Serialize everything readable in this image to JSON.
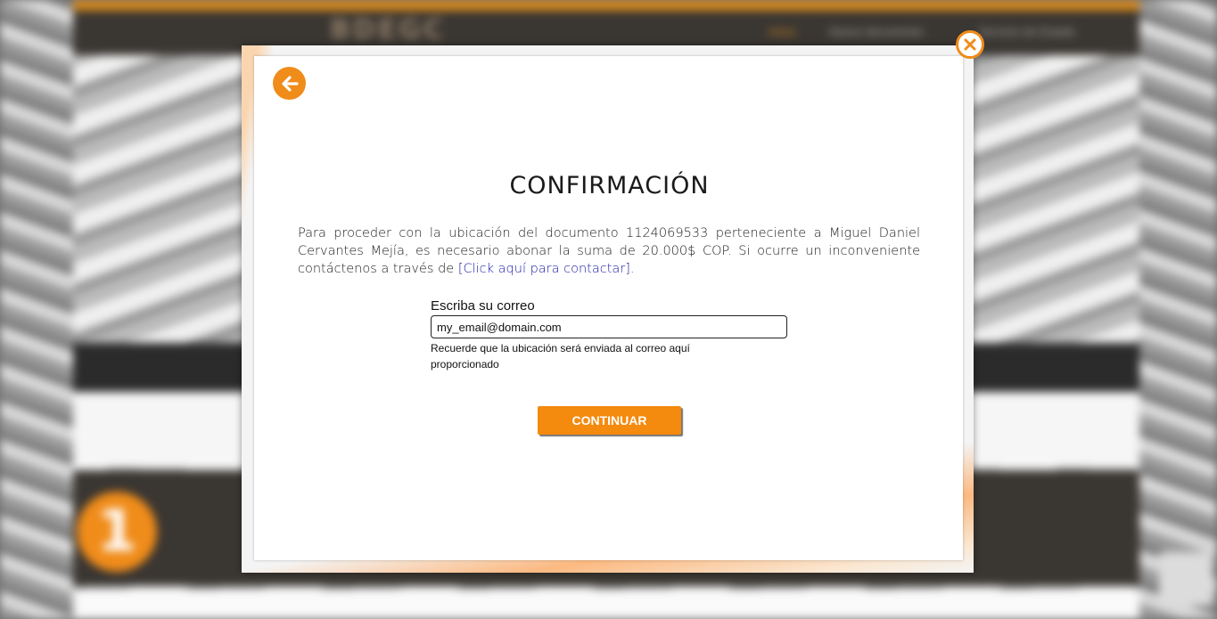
{
  "background": {
    "logo": "BDEGC",
    "nav": [
      "Inicio",
      "Nuevo documento",
      "Servicio de Estado"
    ],
    "step_number": "1"
  },
  "modal": {
    "title": "CONFIRMACIÓN",
    "paragraph_text": "Para proceder con la ubicación del documento 1124069533 perteneciente a Miguel Daniel Cervantes Mejía, es necesario abonar la suma de 20.000$ COP. Si ocurre un inconveniente contáctenos a través de ",
    "contact_link": "[Click aquí para contactar]",
    "paragraph_end": ".",
    "email_label": "Escriba su correo",
    "email_value": "my_email@domain.com",
    "email_hint": "Recuerde que la ubicación será enviada al correo aquí proporcionado",
    "continue_label": "CONTINUAR"
  },
  "colors": {
    "accent": "#f08c1a",
    "link": "#1a1aa8"
  },
  "icons": {
    "close": "close-icon",
    "back": "arrow-left-icon"
  }
}
